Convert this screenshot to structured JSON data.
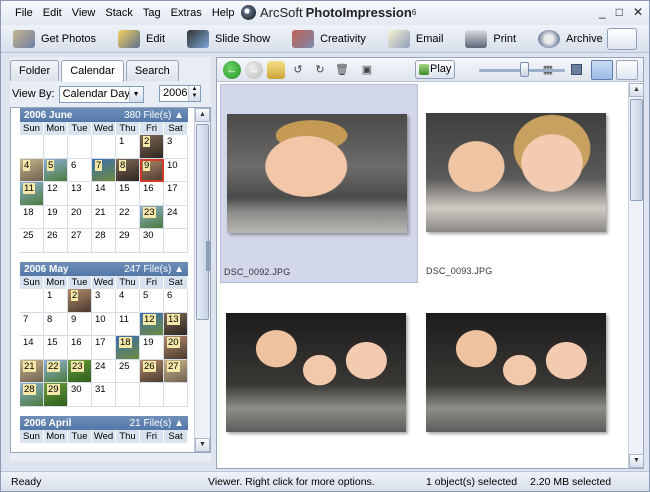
{
  "menu": [
    "File",
    "Edit",
    "View",
    "Stack",
    "Tag",
    "Extras",
    "Help"
  ],
  "app": {
    "brand": "ArcSoft",
    "product": "PhotoImpression",
    "version": "6"
  },
  "window_controls": [
    "_",
    "□",
    "✕"
  ],
  "toolbar": [
    {
      "label": "Get Photos",
      "icon": "get-photos-icon"
    },
    {
      "label": "Edit",
      "icon": "edit-icon"
    },
    {
      "label": "Slide Show",
      "icon": "slideshow-icon"
    },
    {
      "label": "Creativity",
      "icon": "creativity-icon"
    },
    {
      "label": "Email",
      "icon": "email-icon"
    },
    {
      "label": "Print",
      "icon": "print-icon"
    },
    {
      "label": "Archive",
      "icon": "archive-icon"
    }
  ],
  "left": {
    "tabs": [
      "Folder",
      "Calendar",
      "Search"
    ],
    "active_tab": "Calendar",
    "view_by_label": "View By:",
    "view_by_value": "Calendar Day",
    "year": "2006"
  },
  "dow": [
    "Sun",
    "Mon",
    "Tue",
    "Wed",
    "Thu",
    "Fri",
    "Sat"
  ],
  "months": [
    {
      "title": "2006 June",
      "count": "380 File(s)",
      "weeks": [
        [
          "",
          "",
          "",
          "",
          "1",
          "2",
          "3"
        ],
        [
          "4",
          "5",
          "6",
          "7",
          "8",
          "9",
          "10"
        ],
        [
          "11",
          "12",
          "13",
          "14",
          "15",
          "16",
          "17"
        ],
        [
          "18",
          "19",
          "20",
          "21",
          "22",
          "23",
          "24"
        ],
        [
          "25",
          "26",
          "27",
          "28",
          "29",
          "30",
          ""
        ]
      ],
      "photo_days": [
        "2",
        "4",
        "5",
        "7",
        "8",
        "9",
        "11",
        "23"
      ],
      "selected_day": "9"
    },
    {
      "title": "2006 May",
      "count": "247 File(s)",
      "weeks": [
        [
          "",
          "1",
          "2",
          "3",
          "4",
          "5",
          "6"
        ],
        [
          "7",
          "8",
          "9",
          "10",
          "11",
          "12",
          "13"
        ],
        [
          "14",
          "15",
          "16",
          "17",
          "18",
          "19",
          "20"
        ],
        [
          "21",
          "22",
          "23",
          "24",
          "25",
          "26",
          "27"
        ],
        [
          "28",
          "29",
          "30",
          "31",
          "",
          "",
          ""
        ]
      ],
      "photo_days": [
        "2",
        "12",
        "13",
        "18",
        "20",
        "21",
        "22",
        "23",
        "26",
        "27",
        "28",
        "29"
      ],
      "selected_day": ""
    },
    {
      "title": "2006 April",
      "count": "21 File(s)",
      "weeks": [],
      "photo_days": [],
      "selected_day": ""
    }
  ],
  "viewer": {
    "play_label": "Play",
    "slider_value": 0.55,
    "thumbs": [
      {
        "file": "DSC_0092.JPG",
        "selected": true
      },
      {
        "file": "DSC_0093.JPG",
        "selected": false
      },
      {
        "file": "",
        "selected": false
      },
      {
        "file": "",
        "selected": false
      }
    ]
  },
  "status": {
    "left": "Ready",
    "hint": "Viewer. Right click for more options.",
    "selection": "1 object(s) selected",
    "size": "2.20 MB selected"
  }
}
